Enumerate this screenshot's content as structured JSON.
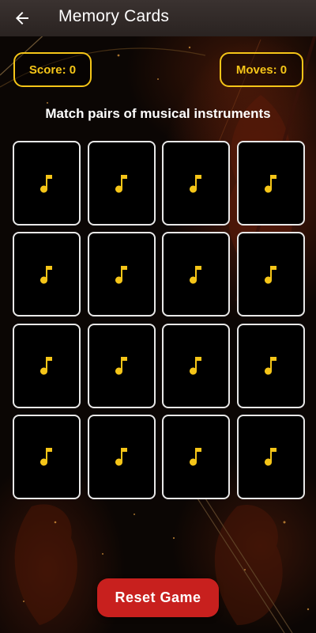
{
  "app_bar": {
    "title": "Memory Cards",
    "back_icon": "arrow-back-icon"
  },
  "stats": {
    "score_label": "Score: 0",
    "moves_label": "Moves: 0"
  },
  "instructions": "Match pairs of musical instruments",
  "cards": {
    "count": 16,
    "face_down_icon": "music-note-icon",
    "state": "face-down"
  },
  "reset_button_label": "Reset Game",
  "colors": {
    "accent": "#f5c518",
    "reset_button": "#c8201e",
    "card_border": "#e8e8e8",
    "card_background": "#000000",
    "app_bar": "#332b29"
  }
}
